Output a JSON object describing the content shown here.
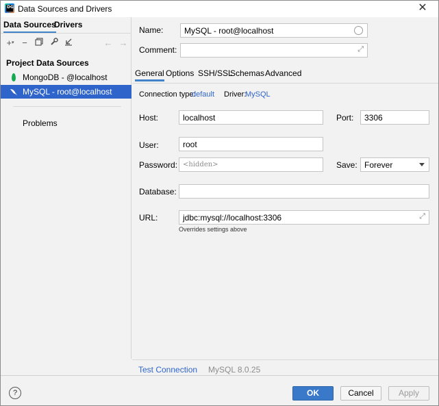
{
  "window": {
    "title": "Data Sources and Drivers",
    "app_icon_text": "DG"
  },
  "left": {
    "tabs": [
      "Data Sources",
      "Drivers"
    ],
    "section_title": "Project Data Sources",
    "items": [
      {
        "label": "MongoDB - @localhost",
        "icon": "mongodb-leaf-icon"
      },
      {
        "label": "MySQL -  root@localhost",
        "icon": "mysql-dolphin-icon"
      }
    ],
    "problems": "Problems",
    "toolbar": {
      "add": "+",
      "remove": "−",
      "copy": "⧉",
      "edit": "🔧",
      "import": "↙",
      "back": "←",
      "forward": "→"
    }
  },
  "form": {
    "name_label": "Name:",
    "name_value": "MySQL -  root@localhost",
    "comment_label": "Comment:",
    "comment_value": "",
    "tabs": [
      "General",
      "Options",
      "SSH/SSL",
      "Schemas",
      "Advanced"
    ],
    "connection_type_label": "Connection type:",
    "connection_type_value": "default",
    "driver_label": "Driver:",
    "driver_value": "MySQL",
    "host_label": "Host:",
    "host_value": "localhost",
    "port_label": "Port:",
    "port_value": "3306",
    "user_label": "User:",
    "user_value": "root",
    "password_label": "Password:",
    "password_placeholder": "<hidden>",
    "save_label": "Save:",
    "save_value": "Forever",
    "database_label": "Database:",
    "database_value": "",
    "url_label": "URL:",
    "url_value": "jdbc:mysql://localhost:3306",
    "url_hint": "Overrides settings above",
    "test_connection": "Test Connection",
    "version": "MySQL 8.0.25"
  },
  "footer": {
    "help": "?",
    "ok": "OK",
    "cancel": "Cancel",
    "apply": "Apply"
  },
  "colors": {
    "accent": "#2f65ca",
    "selection": "#2f65ca",
    "tab_underline": "#4083c9"
  }
}
